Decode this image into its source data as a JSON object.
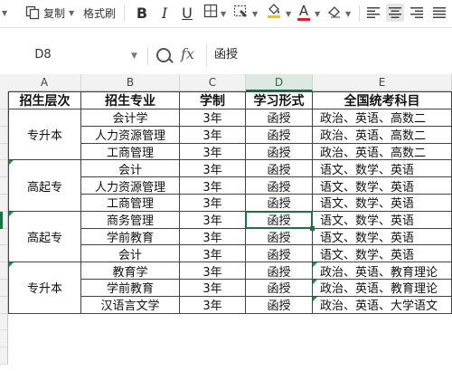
{
  "toolbar": {
    "copy_label": "复制",
    "format_painter_label": "格式刷",
    "bold": "B",
    "italic": "I",
    "underline": "U",
    "font_color_glyph": "A",
    "font_color": "#e02020",
    "fill_color": "#f5c400"
  },
  "formula_bar": {
    "cell_ref": "D8",
    "fx_label": "fx",
    "formula_value": "函授"
  },
  "sheet": {
    "columns": [
      "A",
      "B",
      "C",
      "D",
      "E"
    ],
    "active_column": "D",
    "header_row": [
      "招生层次",
      "招生专业",
      "学制",
      "学习形式",
      "全国统考科目"
    ],
    "groups": [
      {
        "level": "专升本"
      },
      {
        "level": "高起专"
      },
      {
        "level": "高起专"
      },
      {
        "level": "专升本"
      }
    ],
    "rows": [
      {
        "major": "会计学",
        "years": "3年",
        "form": "函授",
        "subjects": "政治、英语、高数二"
      },
      {
        "major": "人力资源管理",
        "years": "3年",
        "form": "函授",
        "subjects": "政治、英语、高数二"
      },
      {
        "major": "工商管理",
        "years": "3年",
        "form": "函授",
        "subjects": "政治、英语、高数二"
      },
      {
        "major": "会计",
        "years": "3年",
        "form": "函授",
        "subjects": "语文、数学、英语"
      },
      {
        "major": "人力资源管理",
        "years": "3年",
        "form": "函授",
        "subjects": "语文、数学、英语"
      },
      {
        "major": "工商管理",
        "years": "3年",
        "form": "函授",
        "subjects": "语文、数学、英语"
      },
      {
        "major": "商务管理",
        "years": "3年",
        "form": "函授",
        "subjects": "语文、数学、英语"
      },
      {
        "major": "学前教育",
        "years": "3年",
        "form": "函授",
        "subjects": "语文、数学、英语"
      },
      {
        "major": "会计",
        "years": "3年",
        "form": "函授",
        "subjects": "语文、数学、英语"
      },
      {
        "major": "教育学",
        "years": "3年",
        "form": "函授",
        "subjects": "政治、英语、教育理论"
      },
      {
        "major": "学前教育",
        "years": "3年",
        "form": "函授",
        "subjects": "政治、英语、教育理论"
      },
      {
        "major": "汉语言文学",
        "years": "3年",
        "form": "函授",
        "subjects": "政治、英语、大学语文"
      }
    ],
    "accent": "#1e7145"
  }
}
